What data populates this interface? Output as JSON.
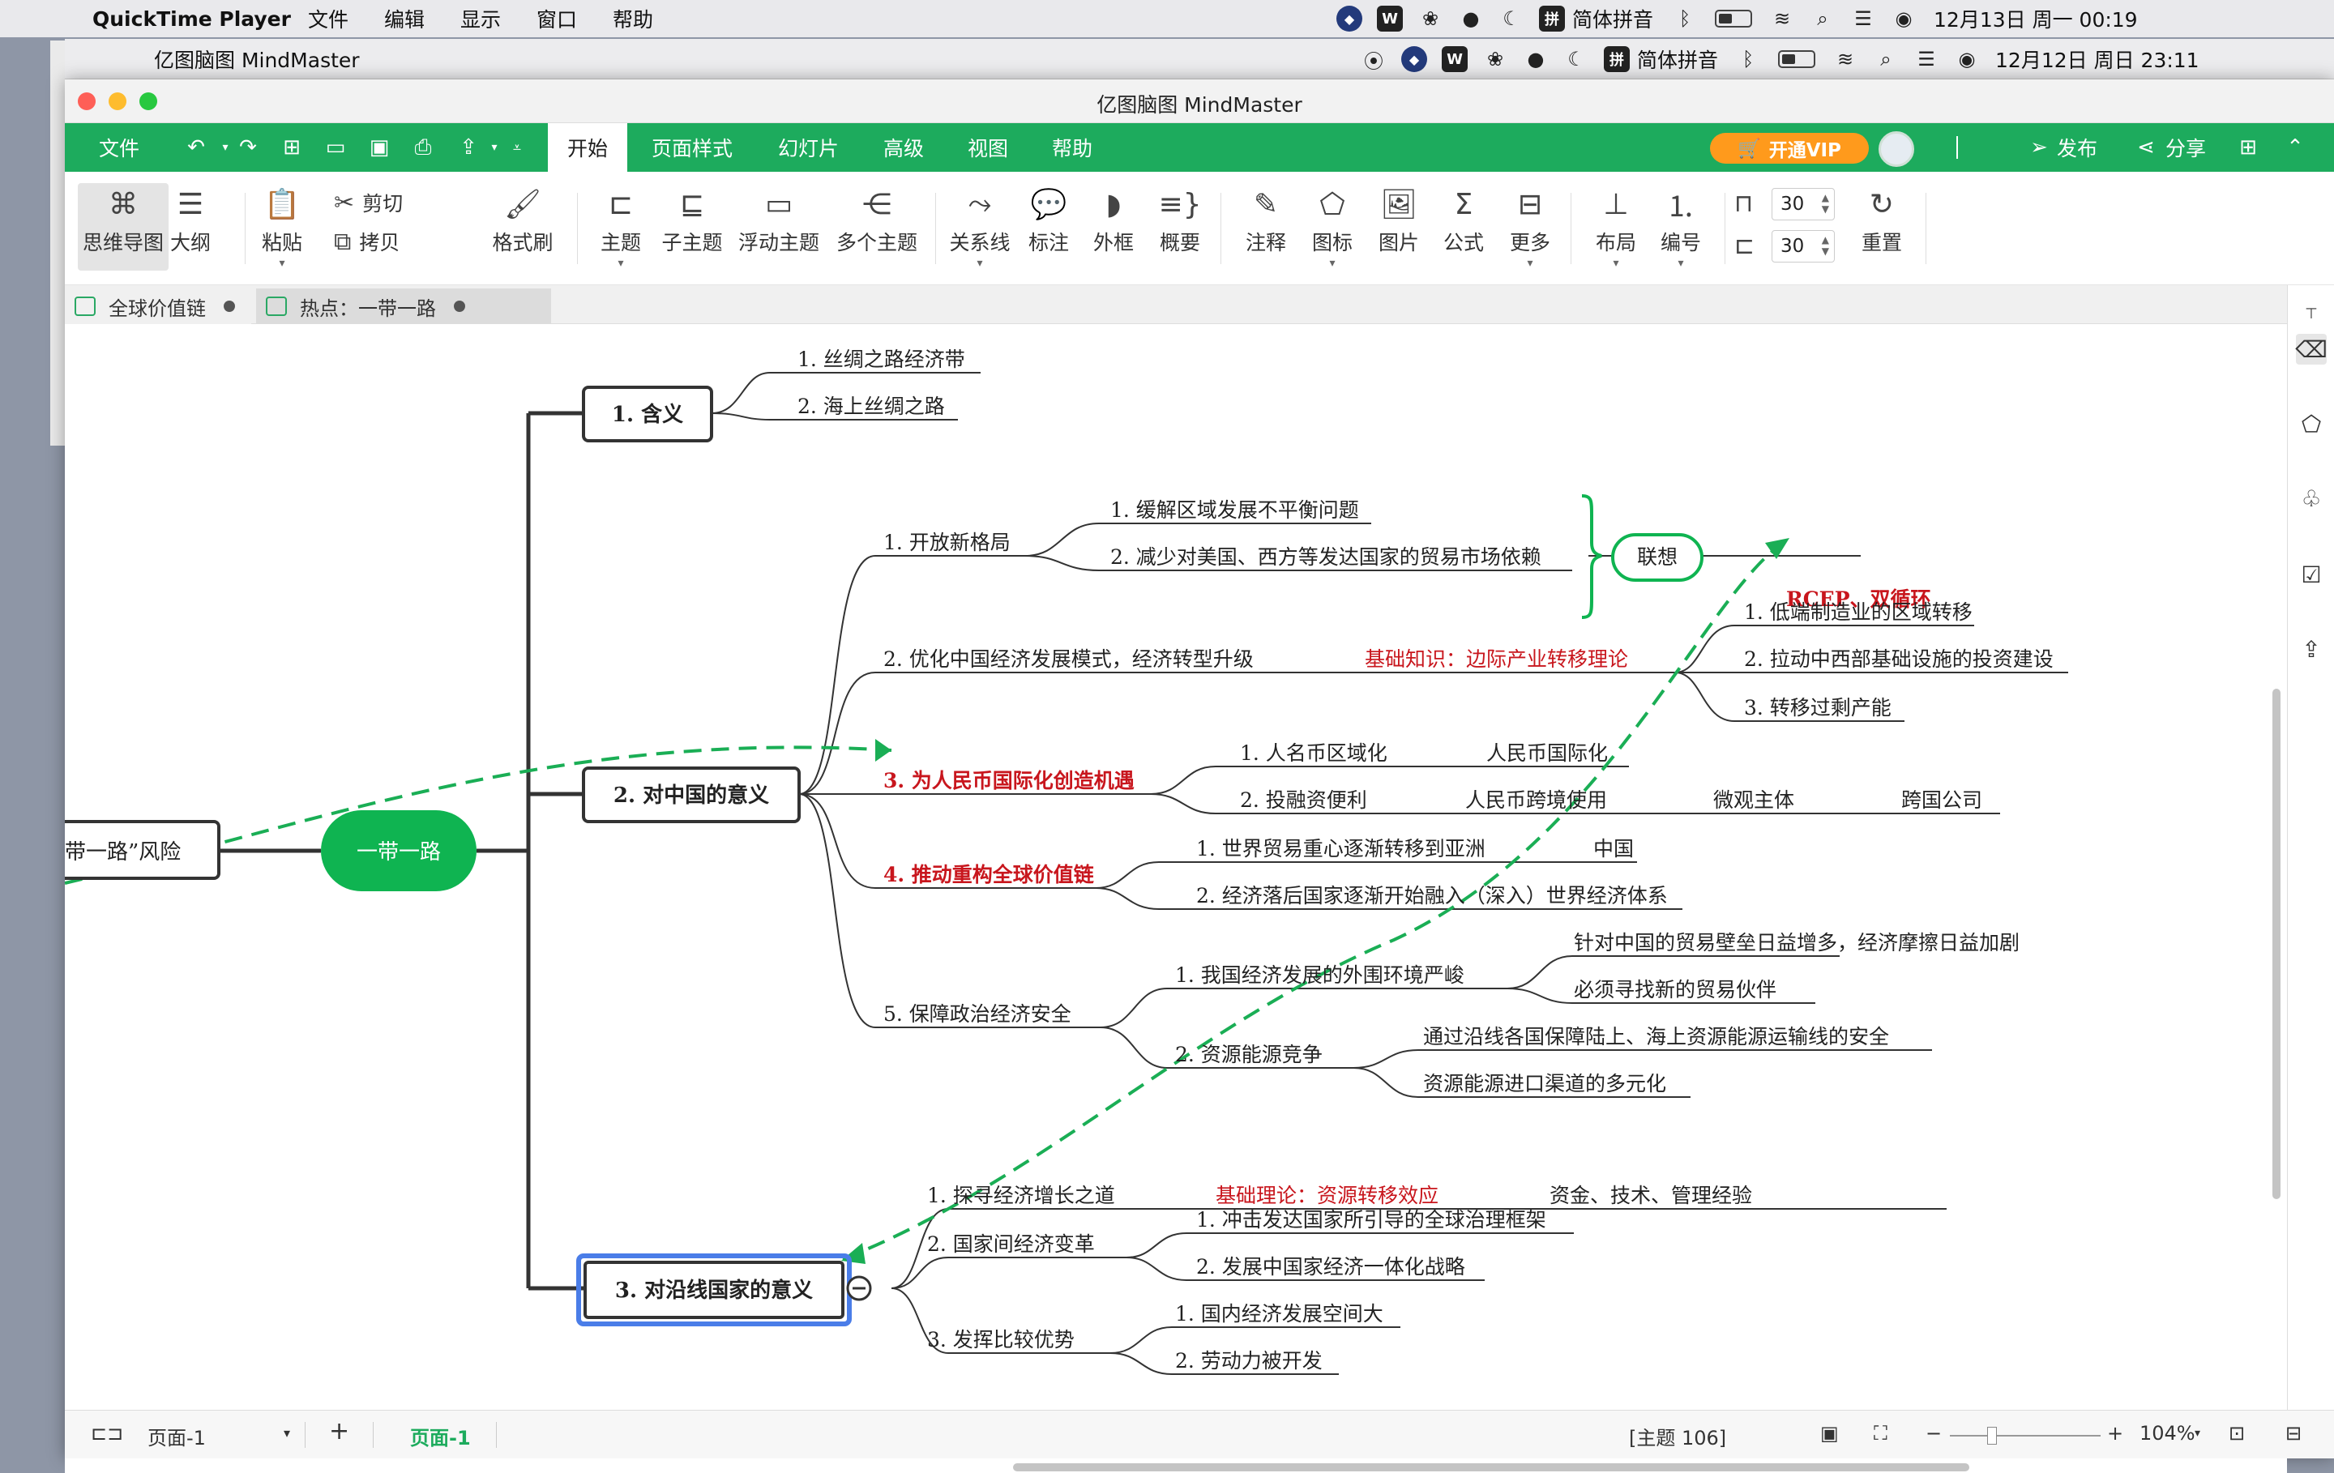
{
  "mac_menubar": {
    "app_name": "QuickTime Player",
    "menus": [
      "文件",
      "编辑",
      "显示",
      "窗口",
      "帮助"
    ],
    "input_method": "简体拼音",
    "datetime": "12月13日 周一  00:19"
  },
  "inner_menubar": {
    "app_name": "亿图脑图 MindMaster",
    "input_method": "简体拼音",
    "datetime": "12月12日 周日  23:11"
  },
  "window": {
    "title": "亿图脑图 MindMaster"
  },
  "menu": {
    "file": "文件",
    "tabs": [
      "开始",
      "页面样式",
      "幻灯片",
      "高级",
      "视图",
      "帮助"
    ],
    "vip": "开通VIP",
    "publish": "发布",
    "share": "分享"
  },
  "ribbon": {
    "mindmap": "思维导图",
    "outline": "大纲",
    "paste": "粘贴",
    "cut": "剪切",
    "copy": "拷贝",
    "format_brush": "格式刷",
    "topic": "主题",
    "subtopic": "子主题",
    "floating": "浮动主题",
    "multi": "多个主题",
    "relation": "关系线",
    "callout": "标注",
    "boundary": "外框",
    "summary": "概要",
    "note": "注释",
    "icon": "图标",
    "image": "图片",
    "formula": "公式",
    "more": "更多",
    "layout": "布局",
    "numbering": "编号",
    "spacing_h": "30",
    "spacing_v": "30",
    "reset": "重置"
  },
  "doc_tabs": [
    "全球价值链",
    "热点：一带一路"
  ],
  "mindmap": {
    "left_node": "带一路”风险",
    "center": "一带一路",
    "b1": "1. 含义",
    "b1_items": [
      "1. 丝绸之路经济带",
      "2. 海上丝绸之路"
    ],
    "b2": "2. 对中国的意义",
    "s1": "1. 开放新格局",
    "s1_items": [
      "1. 缓解区域发展不平衡问题",
      "2. 减少对美国、西方等发达国家的贸易市场依赖"
    ],
    "association": "联想",
    "association_note": "RCEP、双循环",
    "s2": "2. 优化中国经济发展模式，经济转型升级",
    "s2_note": "基础知识：边际产业转移理论",
    "s2_items": [
      "1. 低端制造业的区域转移",
      "2. 拉动中西部基础设施的投资建设",
      "3. 转移过剩产能"
    ],
    "s3": "3. 为人民币国际化创造机遇",
    "s3_i1": "1. 人名币区域化",
    "s3_i1b": "人民币国际化",
    "s3_i2": "2. 投融资便利",
    "s3_i2b": "人民币跨境使用",
    "s3_i2c": "微观主体",
    "s3_i2d": "跨国公司",
    "s4": "4. 推动重构全球价值链",
    "s4_i1": "1. 世界贸易重心逐渐转移到亚洲",
    "s4_i1b": "中国",
    "s4_i2": "2. 经济落后国家逐渐开始融入（深入）世界经济体系",
    "s5": "5. 保障政治经济安全",
    "s5_i1": "1. 我国经济发展的外围环境严峻",
    "s5_i1_items": [
      "针对中国的贸易壁垒日益增多，经济摩擦日益加剧",
      "必须寻找新的贸易伙伴"
    ],
    "s5_i2": "2. 资源能源竞争",
    "s5_i2_items": [
      "通过沿线各国保障陆上、海上资源能源运输线的安全",
      "资源能源进口渠道的多元化"
    ],
    "b3": "3. 对沿线国家的意义",
    "t1": "1. 探寻经济增长之道",
    "t1_note": "基础理论：资源转移效应",
    "t1_b": "资金、技术、管理经验",
    "t2": "2. 国家间经济变革",
    "t2_items": [
      "1. 冲击发达国家所引导的全球治理框架",
      "2. 发展中国家经济一体化战略"
    ],
    "t3": "3. 发挥比较优势",
    "t3_items": [
      "1. 国内经济发展空间大",
      "2. 劳动力被开发"
    ]
  },
  "status": {
    "page_selector": "页面-1",
    "active_page": "页面-1",
    "topic_count": "[主题 106]",
    "zoom": "104%"
  },
  "colors": {
    "brand_green": "#1dab5d",
    "node_green": "#0fb451",
    "accent_red": "#c8161d",
    "selection_blue": "#4a7de8",
    "vip_orange": "#ff9a1c"
  }
}
